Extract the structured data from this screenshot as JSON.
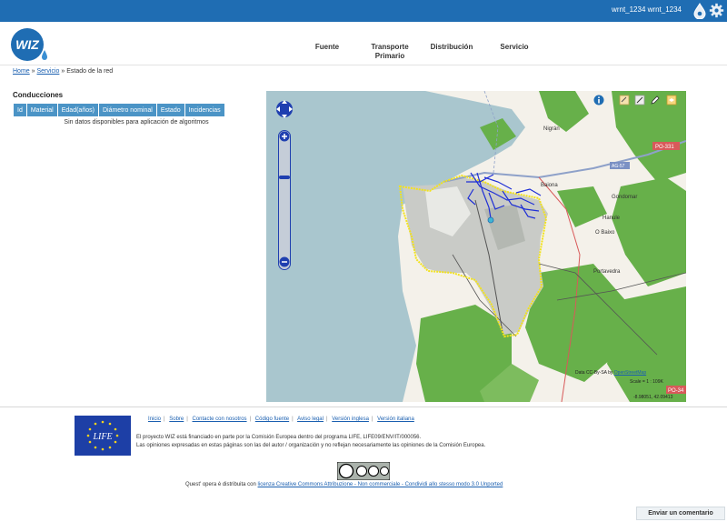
{
  "topbar": {
    "user": "wrnt_1234 wrnt_1234",
    "drop_icon": "water-drop-user-icon",
    "gear_icon": "gear-icon"
  },
  "nav": {
    "items": [
      {
        "label": "Fuente"
      },
      {
        "label": "Transporte Primario"
      },
      {
        "label": "Distribución"
      },
      {
        "label": "Servicio"
      }
    ]
  },
  "breadcrumb": {
    "home": "Home",
    "sep1": "»",
    "servicio": "Servicio",
    "sep2": "»",
    "current": "Estado de la red"
  },
  "conducciones": {
    "title": "Conducciones",
    "columns": [
      "Id",
      "Material",
      "Edad(años)",
      "Diámetro nominal",
      "Estado",
      "Incidencias"
    ],
    "empty_message": "Sin datos disponibles para aplicación de algoritmos"
  },
  "map": {
    "places": [
      "Nigrán",
      "Gondomar",
      "Baiona",
      "Hanule",
      "O Baixo",
      "Portavedra",
      "PO-331",
      "PO-34",
      "AG-57"
    ],
    "attribution": "Data CC-By-SA by",
    "attribution_link": "OpenStreetMap",
    "scale": "Scale = 1 : 109K",
    "coords": "-8.98051, 42.09413"
  },
  "footer": {
    "links": [
      "Inicio",
      "Sobre",
      "Contacte con nosotros",
      "Código fuente",
      "Aviso legal",
      "Versión inglesa",
      "Versión italiana"
    ],
    "separator": "|",
    "funding_text": "El proyecto WIZ está financiado en parte por la Comisión Europea dentro del programa LIFE, LIFE09/ENV/IT/000056.",
    "disclaimer_text": "Las opiniones expresadas en estas páginas son las del autor / organización y no reflejan necesariamente las opiniones de la Comisión Europea.",
    "license_prefix": "Quest' opera è distribuita con",
    "license_link": "licenza Creative Commons Attribuzione - Non commerciale - Condividi allo stesso modo 3.0 Unported",
    "comment_button": "Enviar un comentario",
    "eu_logo_text": "LIFE",
    "brand": "WIZ"
  },
  "colors": {
    "topbar": "#1f6db3",
    "table_header": "#4b94c6",
    "link": "#1a5fb0",
    "water": "#a9c6ce",
    "forest": "#67b04a",
    "network": "#1f2fd6",
    "boundary": "#f2e21d"
  }
}
